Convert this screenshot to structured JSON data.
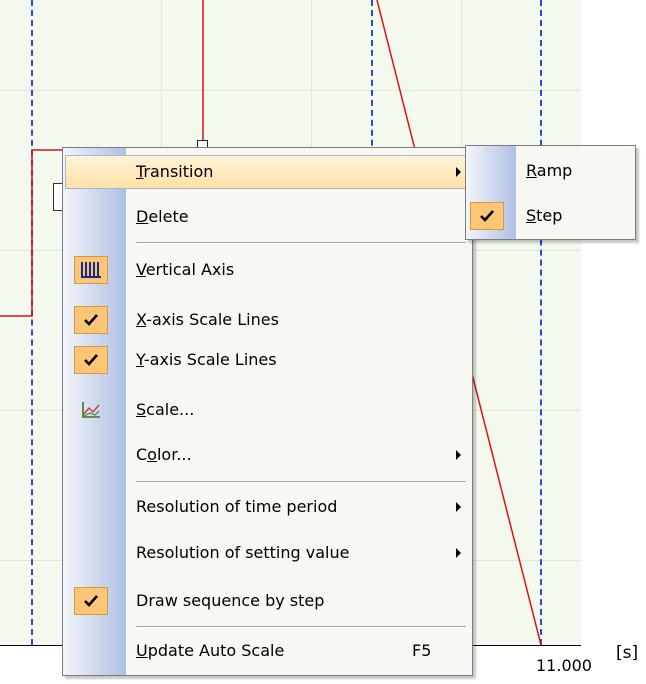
{
  "chart": {
    "unit": "[s]",
    "x_tick": "11.000"
  },
  "context_menu": {
    "items": [
      {
        "label": "Transition",
        "mnemonic": "T",
        "rest": "ransition",
        "has_submenu": true,
        "highlighted": true
      },
      {
        "label": "Delete",
        "mnemonic": "D",
        "rest": "elete"
      },
      {
        "label": "Vertical Axis",
        "mnemonic": "V",
        "rest": "ertical Axis",
        "icon": "vertical-axis-icon",
        "checked_style": true
      },
      {
        "label": "X-axis Scale Lines",
        "mnemonic": "X",
        "rest": "-axis Scale Lines",
        "checked": true
      },
      {
        "label": "Y-axis Scale Lines",
        "mnemonic": "Y",
        "rest": "-axis Scale Lines",
        "checked": true
      },
      {
        "label": "Scale...",
        "mnemonic": "S",
        "rest": "cale...",
        "icon": "scale-chart-icon"
      },
      {
        "label": "Color...",
        "mnemonic_pre": "C",
        "mnemonic": "o",
        "rest": "lor...",
        "has_submenu": true
      },
      {
        "label": "Resolution of time period",
        "has_submenu": true
      },
      {
        "label": "Resolution of setting value",
        "has_submenu": true
      },
      {
        "label": "Draw sequence by step",
        "checked": true
      },
      {
        "label": "Update Auto Scale",
        "mnemonic": "U",
        "rest": "pdate Auto Scale",
        "shortcut": "F5"
      }
    ]
  },
  "submenu": {
    "items": [
      {
        "label": "Ramp",
        "mnemonic": "R",
        "rest": "amp",
        "checked": false
      },
      {
        "label": "Step",
        "mnemonic": "S",
        "rest": "tep",
        "checked": true
      }
    ]
  },
  "colors": {
    "plot_background": "#f4f9ef",
    "dashed_line": "#2a4bd6",
    "signal_line": "#e01010",
    "menu_highlight": "#fde1a6",
    "check_background": "#fcc679"
  }
}
